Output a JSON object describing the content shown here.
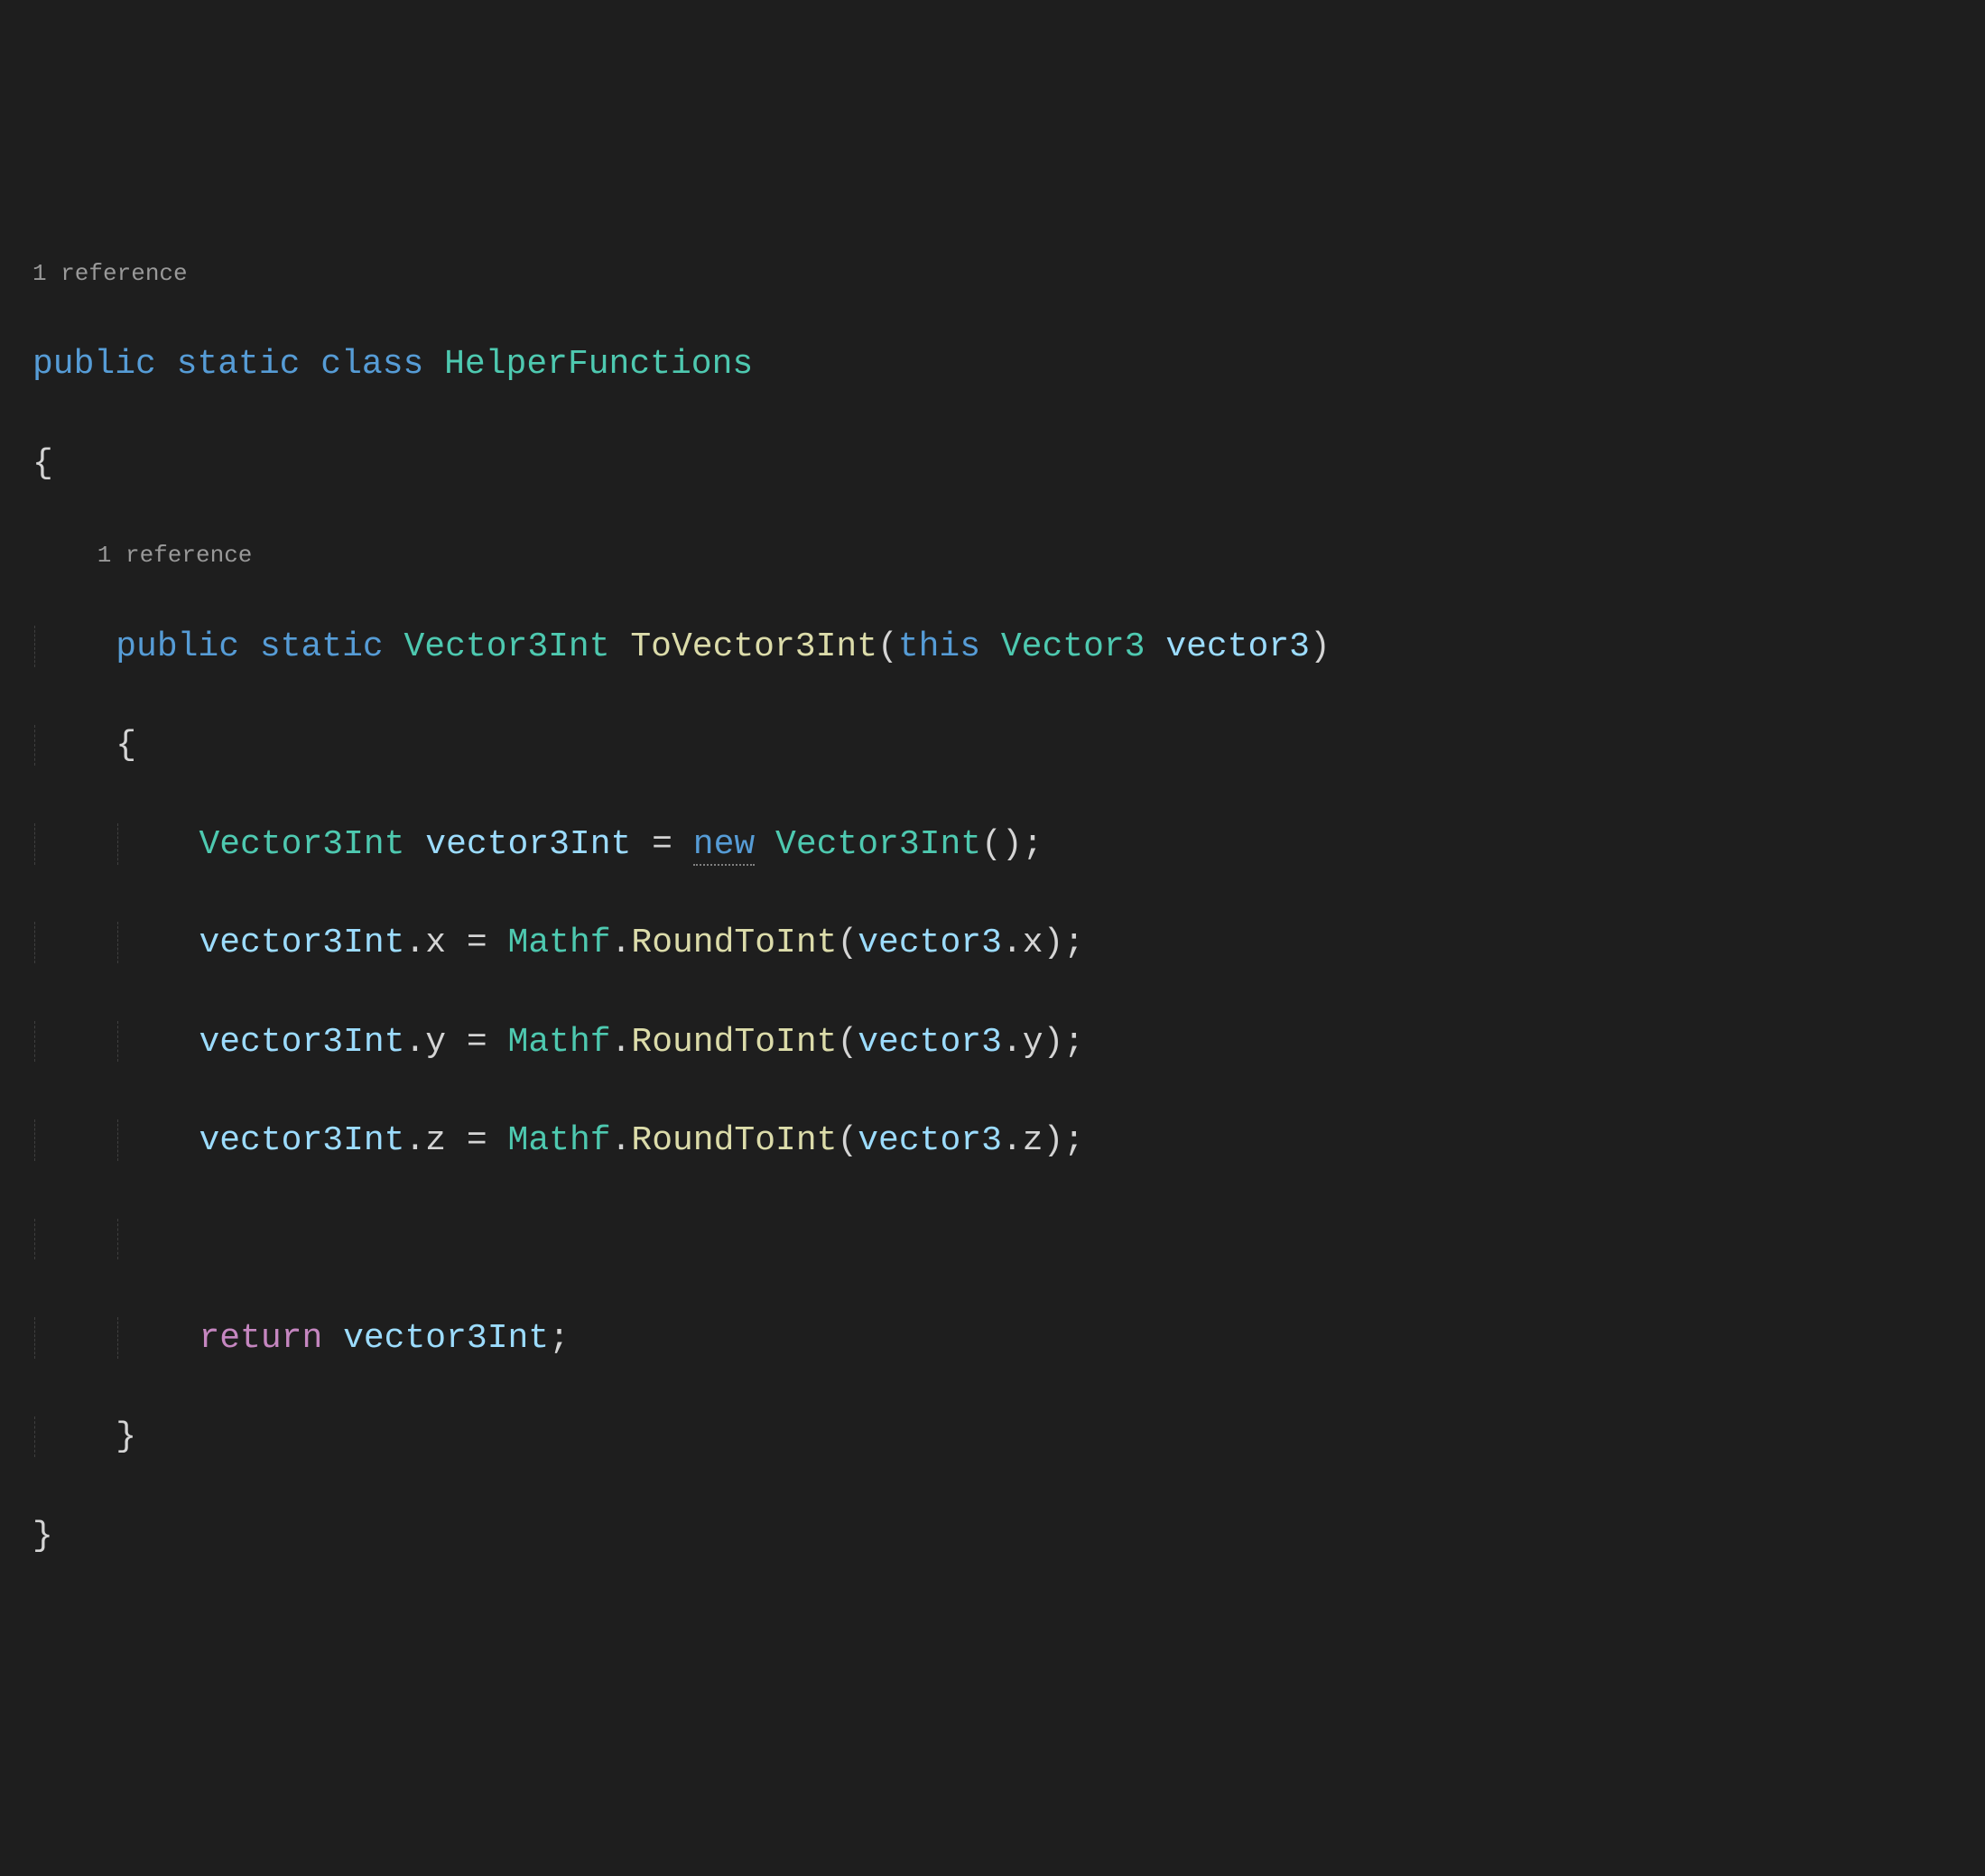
{
  "colors": {
    "background": "#1e1e1e",
    "keyword": "#569cd6",
    "type": "#4ec9b0",
    "method": "#dcdcaa",
    "identifier": "#9cdcfe",
    "control": "#c586c0",
    "codelens": "#999999",
    "default": "#d4d4d4"
  },
  "codelens": {
    "classRef": "1 reference",
    "methodRef": "1 reference"
  },
  "tokens": {
    "public": "public",
    "static": "static",
    "class": "class",
    "className": "HelperFunctions",
    "Vector3Int": "Vector3Int",
    "methodName": "ToVector3Int",
    "this": "this",
    "Vector3": "Vector3",
    "paramName": "vector3",
    "localName": "vector3Int",
    "eq": "=",
    "new": "new",
    "Mathf": "Mathf",
    "RoundToInt": "RoundToInt",
    "x": "x",
    "y": "y",
    "z": "z",
    "return": "return",
    "openParen": "(",
    "closeParen": ")",
    "openBrace": "{",
    "closeBrace": "}",
    "semicolon": ";",
    "dot": ".",
    "emptyParens": "()"
  }
}
